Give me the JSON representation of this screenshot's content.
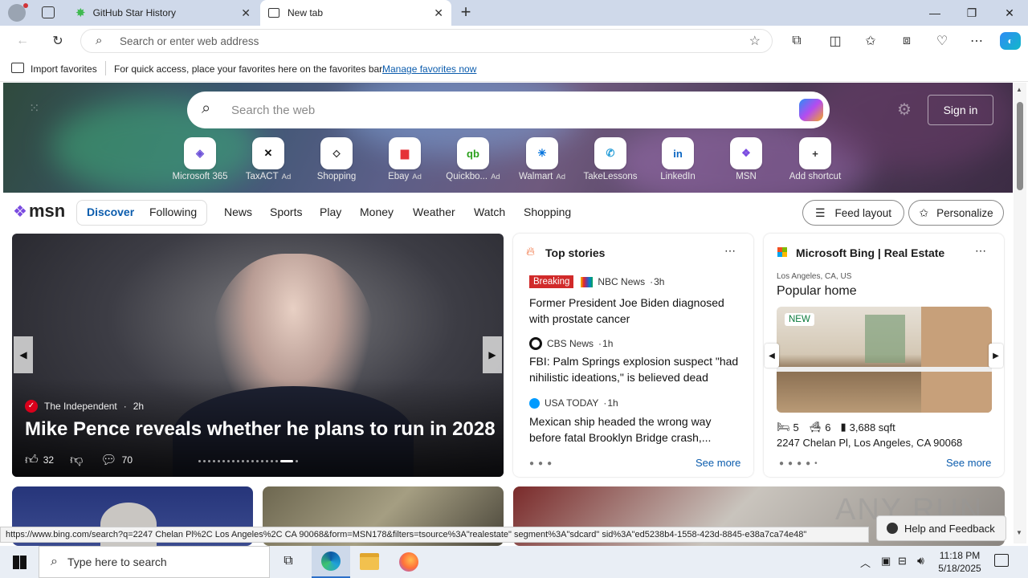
{
  "tabs": [
    {
      "label": "GitHub Star History",
      "active": false
    },
    {
      "label": "New tab",
      "active": true
    }
  ],
  "address_bar": {
    "placeholder": "Search or enter web address"
  },
  "favorites_bar": {
    "import_label": "Import favorites",
    "message": "For quick access, place your favorites here on the favorites bar.",
    "manage_link": "Manage favorites now"
  },
  "hero": {
    "search_placeholder": "Search the web",
    "sign_in": "Sign in",
    "shortcuts": [
      {
        "label": "Microsoft 365",
        "ad": "",
        "icon": "m365-icon",
        "glyph": "◈",
        "color": "#6b4fd8"
      },
      {
        "label": "TaxACT",
        "ad": "Ad",
        "icon": "taxact-icon",
        "glyph": "✕",
        "color": "#111111"
      },
      {
        "label": "Shopping",
        "ad": "",
        "icon": "tag-icon",
        "glyph": "⬦",
        "color": "#333333"
      },
      {
        "label": "Ebay",
        "ad": "Ad",
        "icon": "ebay-icon",
        "glyph": "▆",
        "color": "#e53238"
      },
      {
        "label": "Quickbo...",
        "ad": "Ad",
        "icon": "quickbooks-icon",
        "glyph": "qb",
        "color": "#2ca01c"
      },
      {
        "label": "Walmart",
        "ad": "Ad",
        "icon": "walmart-icon",
        "glyph": "✳",
        "color": "#0071dc"
      },
      {
        "label": "TakeLessons",
        "ad": "",
        "icon": "takelessons-icon",
        "glyph": "✆",
        "color": "#2a9fd8"
      },
      {
        "label": "LinkedIn",
        "ad": "",
        "icon": "linkedin-icon",
        "glyph": "in",
        "color": "#0a66c2"
      },
      {
        "label": "MSN",
        "ad": "",
        "icon": "msn-icon",
        "glyph": "❖",
        "color": "#7a4be0"
      },
      {
        "label": "Add shortcut",
        "ad": "",
        "icon": "plus-icon",
        "glyph": "+",
        "color": "#333333"
      }
    ]
  },
  "msn": {
    "logo": "msn",
    "tabs": [
      "Discover",
      "Following"
    ],
    "nav": [
      "News",
      "Sports",
      "Play",
      "Money",
      "Weather",
      "Watch",
      "Shopping"
    ],
    "feed_layout": "Feed layout",
    "personalize": "Personalize"
  },
  "main_story": {
    "source": "The Independent",
    "age": "2h",
    "headline": "Mike Pence reveals whether he plans to run in 2028",
    "likes": "32",
    "comments": "70"
  },
  "top_stories": {
    "title": "Top stories",
    "items": [
      {
        "badge": "Breaking",
        "source": "NBC News",
        "age": "3h",
        "headline": "Former President Joe Biden diagnosed with prostate cancer"
      },
      {
        "badge": "",
        "source": "CBS News",
        "age": "1h",
        "headline": "FBI: Palm Springs explosion suspect \"had nihilistic ideations,\" is believed dead"
      },
      {
        "badge": "",
        "source": "USA TODAY",
        "age": "1h",
        "headline": "Mexican ship headed the wrong way before fatal Brooklyn Bridge crash,..."
      }
    ],
    "see_more": "See more"
  },
  "real_estate": {
    "title": "Microsoft Bing | Real Estate",
    "location": "Los Angeles, CA, US",
    "heading": "Popular home",
    "badge": "NEW",
    "beds": "5",
    "baths": "6",
    "sqft": "3,688 sqft",
    "address": "2247 Chelan Pl, Los Angeles, CA 90068",
    "see_more": "See more"
  },
  "status_url": "https://www.bing.com/search?q=2247 Chelan Pl%2C Los Angeles%2C CA 90068&form=MSN178&filters=tsource%3A\"realestate\" segment%3A\"sdcard\" sid%3A\"ed5238b4-1558-423d-8845-e38a7ca74e48\"",
  "help_feedback": "Help and Feedback",
  "watermark": "ANY RUN",
  "taskbar": {
    "search_placeholder": "Type here to search",
    "time": "11:18 PM",
    "date": "5/18/2025"
  }
}
